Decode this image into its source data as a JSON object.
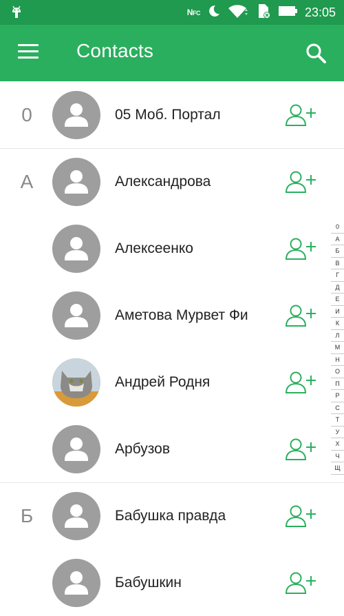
{
  "status_bar": {
    "time": "23:05",
    "nfc_label": "N",
    "nfc_sub": "FC",
    "icons": [
      "android-icon",
      "nfc-icon",
      "moon-icon",
      "wifi-icon",
      "sd-card-icon",
      "battery-icon"
    ]
  },
  "app_bar": {
    "title": "Contacts",
    "menu_icon": "menu-icon",
    "search_icon": "search-icon"
  },
  "contacts": [
    {
      "letter": "0",
      "name": "05 Моб. Портал",
      "photo": false
    },
    {
      "letter": "А",
      "name": "Александрова",
      "photo": false
    },
    {
      "letter": "",
      "name": "Алексеенко",
      "photo": false
    },
    {
      "letter": "",
      "name": "Аметова Мурвет Фи",
      "photo": false
    },
    {
      "letter": "",
      "name": "Андрей Родня",
      "photo": true
    },
    {
      "letter": "",
      "name": "Арбузов",
      "photo": false
    },
    {
      "letter": "Б",
      "name": "Бабушка правда",
      "photo": false
    },
    {
      "letter": "",
      "name": "Бабушкин",
      "photo": false
    }
  ],
  "index_letters": [
    "0",
    "А",
    "Б",
    "В",
    "Г",
    "Д",
    "Е",
    "И",
    "К",
    "Л",
    "М",
    "Н",
    "О",
    "П",
    "Р",
    "С",
    "Т",
    "У",
    "Х",
    "Ч",
    "Щ"
  ],
  "colors": {
    "status_bar": "#1f9a4e",
    "app_bar": "#2aaf5e",
    "accent": "#2aaf5e",
    "avatar_placeholder": "#9e9e9e"
  }
}
